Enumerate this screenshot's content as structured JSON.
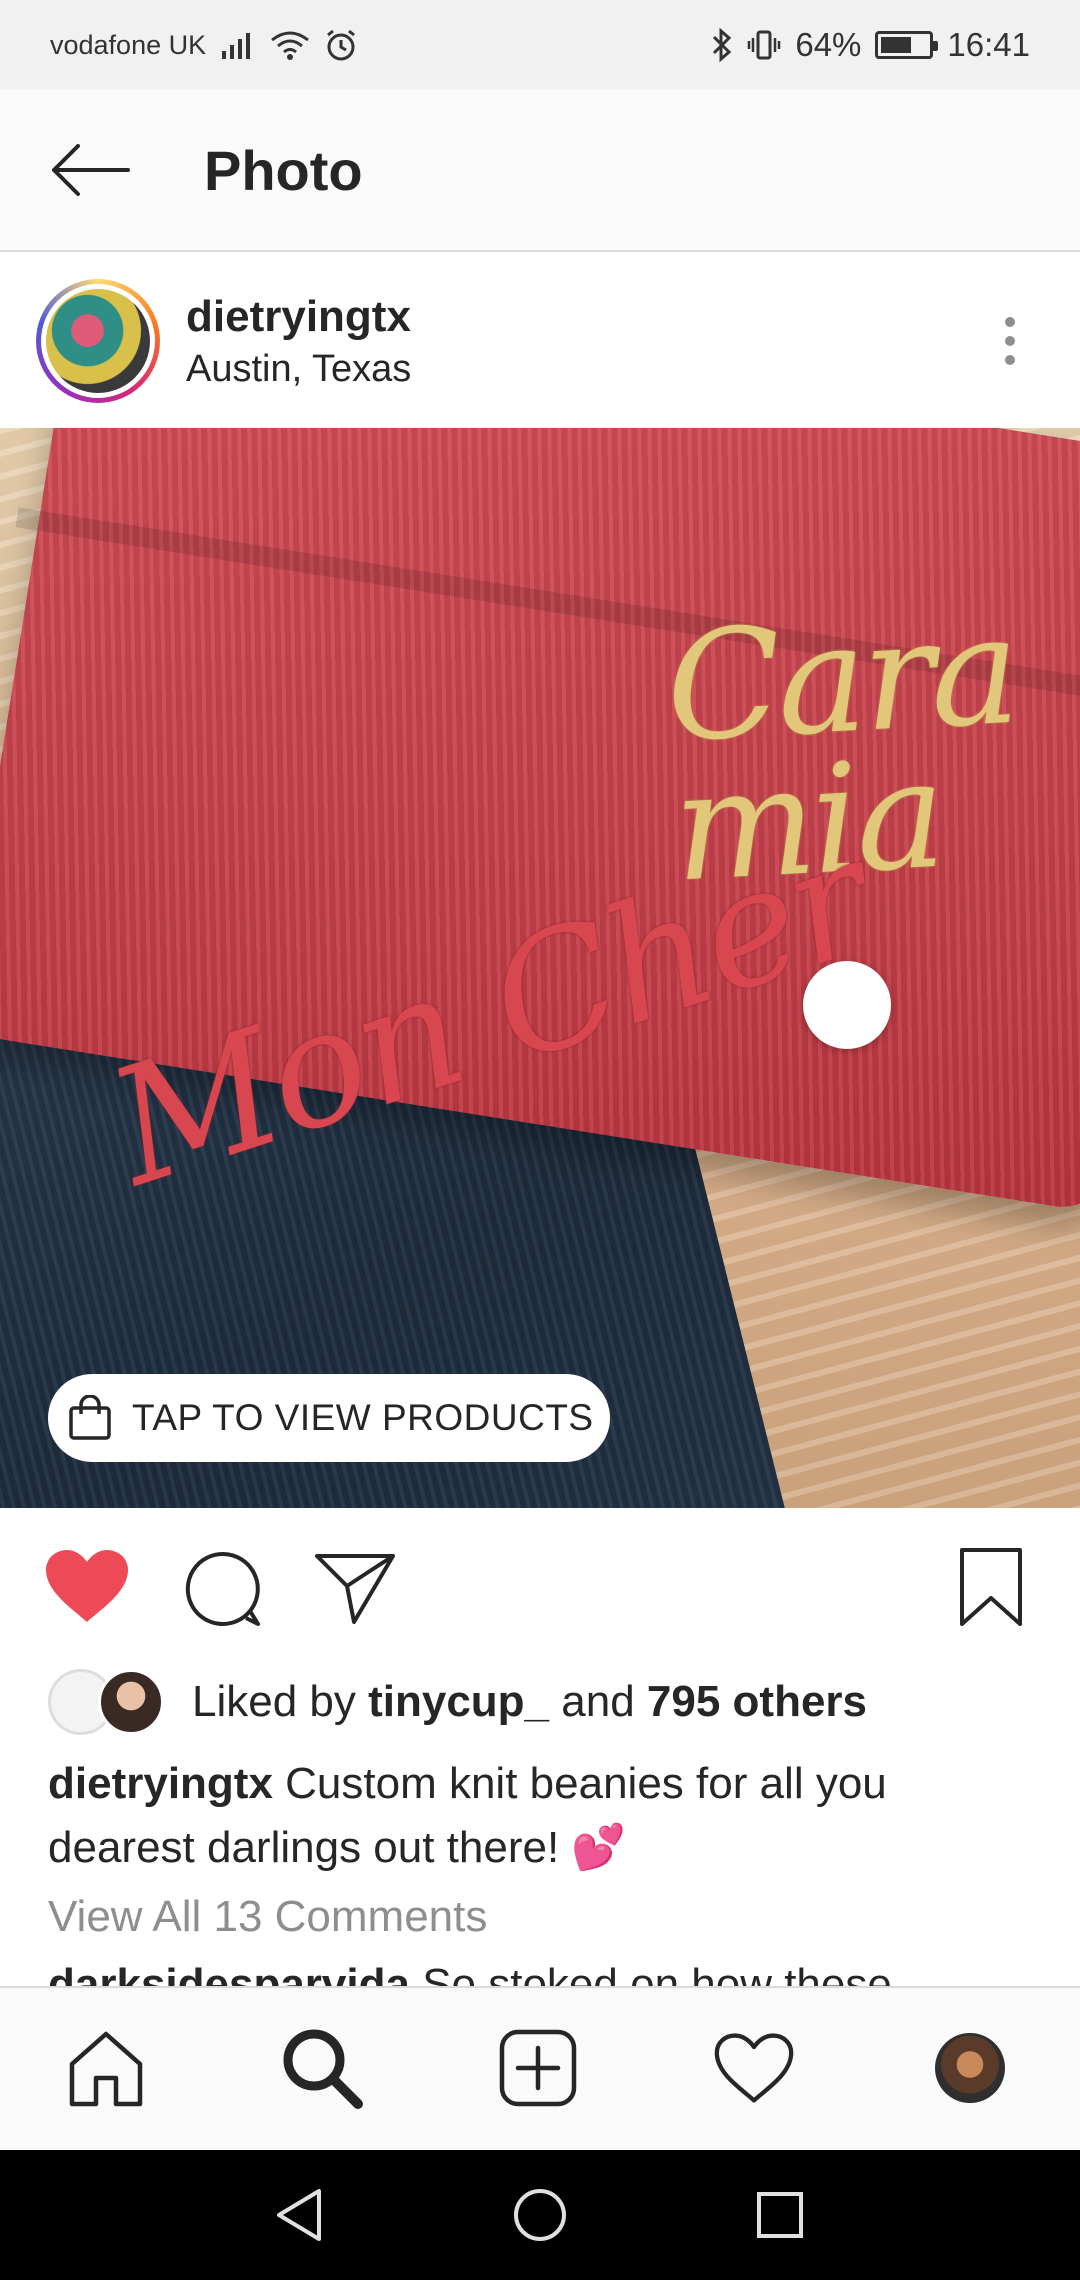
{
  "status_bar": {
    "carrier": "vodafone UK",
    "battery": "64%",
    "battery_level": 0.64,
    "time": "16:41",
    "icons": [
      "signal-icon",
      "wifi-icon",
      "alarm-icon",
      "bluetooth-icon",
      "vibrate-icon",
      "battery-icon"
    ]
  },
  "app_bar": {
    "title": "Photo",
    "back_icon": "arrow-left-icon"
  },
  "post": {
    "username": "dietryingtx",
    "location": "Austin, Texas",
    "photo": {
      "text_red_beanie": "Cara mia",
      "text_navy_beanie": "Mon Cher",
      "products_button": "TAP TO VIEW PRODUCTS"
    },
    "likes": {
      "prefix": "Liked by ",
      "user": "tinycup_",
      "middle": " and ",
      "others": "795 others"
    },
    "caption": {
      "user": "dietryingtx",
      "text": " Custom knit beanies for all you dearest darlings out there! 💕"
    },
    "view_comments": "View All 13 Comments",
    "next_comment": {
      "user": "darksidesparvida",
      "text": " So stoked on how these"
    }
  },
  "colors": {
    "like_red": "#ed4956",
    "text": "#262626",
    "muted": "#8e8e8e"
  }
}
